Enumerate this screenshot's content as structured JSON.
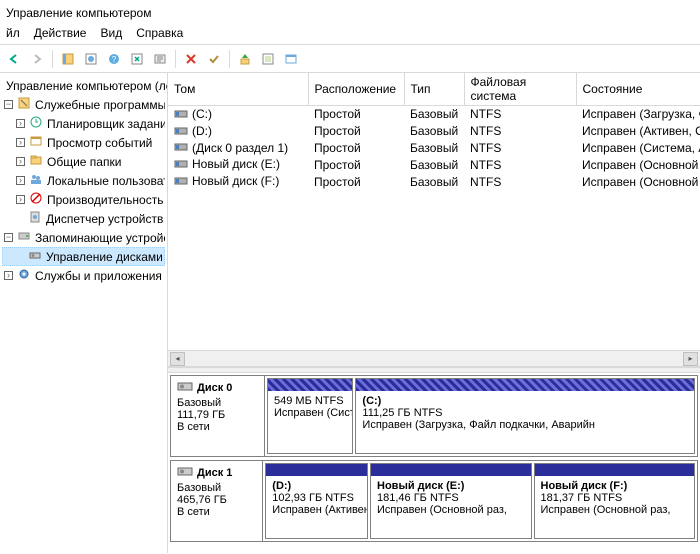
{
  "window": {
    "title": "Управление компьютером"
  },
  "menu": {
    "file": "йл",
    "action": "Действие",
    "view": "Вид",
    "help": "Справка"
  },
  "tree": {
    "root": "Управление компьютером (лс",
    "items": [
      {
        "label": "Служебные программы",
        "icon": "tools",
        "expand": "-"
      },
      {
        "label": "Планировщик заданий",
        "icon": "clock",
        "depth": 2,
        "expand": ">"
      },
      {
        "label": "Просмотр событий",
        "icon": "event",
        "depth": 2,
        "expand": ">"
      },
      {
        "label": "Общие папки",
        "icon": "folder",
        "depth": 2,
        "expand": ">"
      },
      {
        "label": "Локальные пользовате",
        "icon": "users",
        "depth": 2,
        "expand": ">"
      },
      {
        "label": "Производительность",
        "icon": "perf",
        "depth": 2,
        "expand": ">"
      },
      {
        "label": "Диспетчер устройств",
        "icon": "device",
        "depth": 2
      },
      {
        "label": "Запоминающие устройс",
        "icon": "storage",
        "expand": "-"
      },
      {
        "label": "Управление дисками",
        "icon": "disk",
        "depth": 2,
        "selected": true
      },
      {
        "label": "Службы и приложения",
        "icon": "services",
        "expand": ">"
      }
    ]
  },
  "volumes": {
    "headers": {
      "volume": "Том",
      "layout": "Расположение",
      "type": "Тип",
      "fs": "Файловая система",
      "status": "Состояние"
    },
    "rows": [
      {
        "name": "(C:)",
        "layout": "Простой",
        "type": "Базовый",
        "fs": "NTFS",
        "status": "Исправен (Загрузка, Файл подкачки,"
      },
      {
        "name": "(D:)",
        "layout": "Простой",
        "type": "Базовый",
        "fs": "NTFS",
        "status": "Исправен (Активен, Основной разде"
      },
      {
        "name": "(Диск 0 раздел 1)",
        "layout": "Простой",
        "type": "Базовый",
        "fs": "NTFS",
        "status": "Исправен (Система, Активен, Основ"
      },
      {
        "name": "Новый диск (E:)",
        "layout": "Простой",
        "type": "Базовый",
        "fs": "NTFS",
        "status": "Исправен (Основной раздел)"
      },
      {
        "name": "Новый диск (F:)",
        "layout": "Простой",
        "type": "Базовый",
        "fs": "NTFS",
        "status": "Исправен (Основной раздел)"
      }
    ]
  },
  "disks": [
    {
      "name": "Диск 0",
      "type": "Базовый",
      "size": "111,79 ГБ",
      "status": "В сети",
      "parts": [
        {
          "name": "",
          "line2": "549 МБ NTFS",
          "line3": "Исправен (Система, Ак",
          "flex": 0.2,
          "sys": true
        },
        {
          "name": "(C:)",
          "line2": "111,25 ГБ NTFS",
          "line3": "Исправен (Загрузка, Файл подкачки, Аварийн",
          "flex": 0.8,
          "sys": true
        }
      ]
    },
    {
      "name": "Диск 1",
      "type": "Базовый",
      "size": "465,76 ГБ",
      "status": "В сети",
      "parts": [
        {
          "name": "(D:)",
          "line2": "102,93 ГБ NTFS",
          "line3": "Исправен (Активен, Осн",
          "flex": 0.24
        },
        {
          "name": "Новый диск  (E:)",
          "line2": "181,46 ГБ NTFS",
          "line3": "Исправен (Основной раз,",
          "flex": 0.38
        },
        {
          "name": "Новый диск  (F:)",
          "line2": "181,37 ГБ NTFS",
          "line3": "Исправен (Основной раз,",
          "flex": 0.38
        }
      ]
    }
  ]
}
